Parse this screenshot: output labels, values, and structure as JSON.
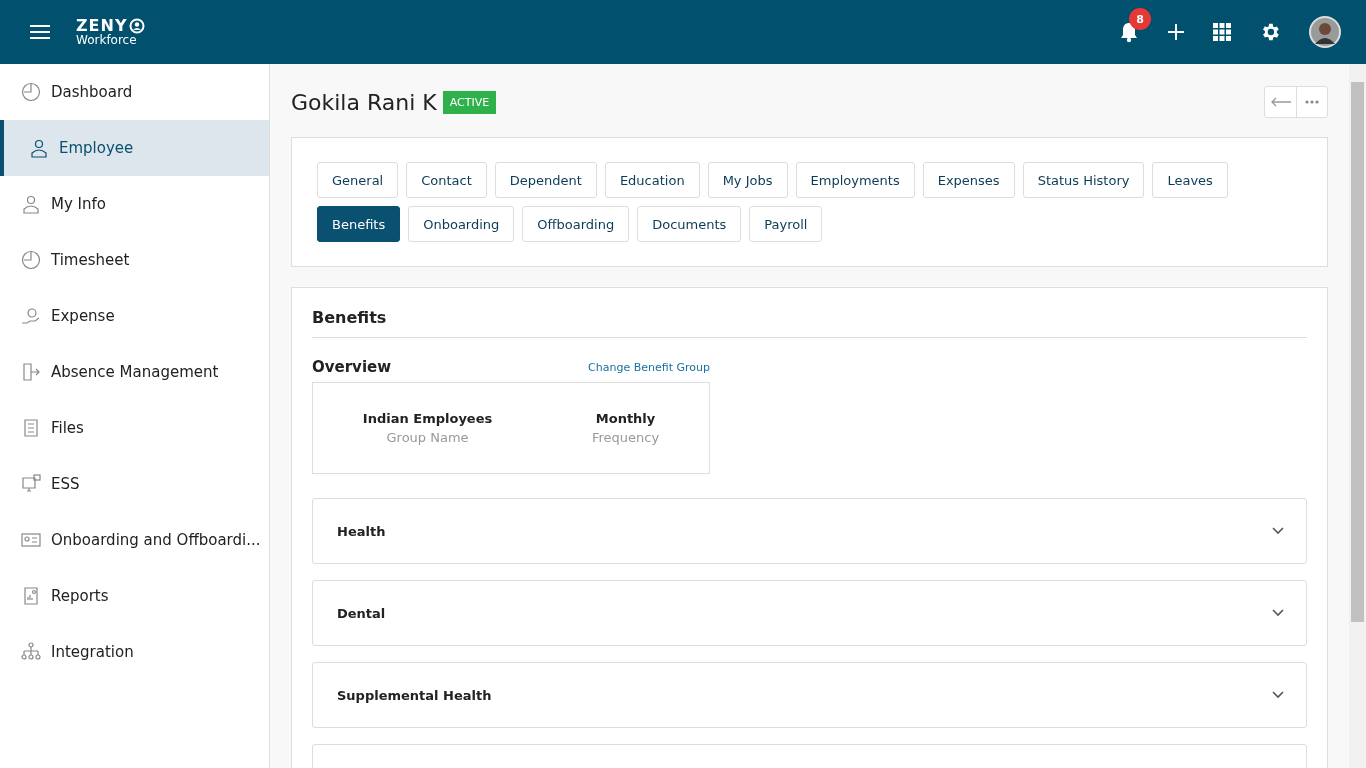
{
  "header": {
    "logo_top": "ZENY",
    "logo_bottom": "Workforce",
    "notifications": "8"
  },
  "sidebar": {
    "items": [
      {
        "label": "Dashboard",
        "selected": false
      },
      {
        "label": "Employee",
        "selected": true
      },
      {
        "label": "My Info",
        "selected": false
      },
      {
        "label": "Timesheet",
        "selected": false
      },
      {
        "label": "Expense",
        "selected": false
      },
      {
        "label": "Absence Management",
        "selected": false
      },
      {
        "label": "Files",
        "selected": false
      },
      {
        "label": "ESS",
        "selected": false
      },
      {
        "label": "Onboarding and Offboardi...",
        "selected": false
      },
      {
        "label": "Reports",
        "selected": false
      },
      {
        "label": "Integration",
        "selected": false
      }
    ]
  },
  "employee": {
    "name": "Gokila Rani K",
    "status": "ACTIVE"
  },
  "tabs": [
    {
      "label": "General",
      "selected": false
    },
    {
      "label": "Contact",
      "selected": false
    },
    {
      "label": "Dependent",
      "selected": false
    },
    {
      "label": "Education",
      "selected": false
    },
    {
      "label": "My Jobs",
      "selected": false
    },
    {
      "label": "Employments",
      "selected": false
    },
    {
      "label": "Expenses",
      "selected": false
    },
    {
      "label": "Status History",
      "selected": false
    },
    {
      "label": "Leaves",
      "selected": false
    },
    {
      "label": "Benefits",
      "selected": true
    },
    {
      "label": "Onboarding",
      "selected": false
    },
    {
      "label": "Offboarding",
      "selected": false
    },
    {
      "label": "Documents",
      "selected": false
    },
    {
      "label": "Payroll",
      "selected": false
    }
  ],
  "benefits": {
    "title": "Benefits",
    "overview_title": "Overview",
    "change_link": "Change Benefit Group",
    "overview": [
      {
        "value": "Indian Employees",
        "label": "Group Name"
      },
      {
        "value": "Monthly",
        "label": "Frequency"
      }
    ],
    "sections": [
      {
        "title": "Health",
        "expanded": false
      },
      {
        "title": "Dental",
        "expanded": false
      },
      {
        "title": "Supplemental Health",
        "expanded": false
      }
    ]
  }
}
